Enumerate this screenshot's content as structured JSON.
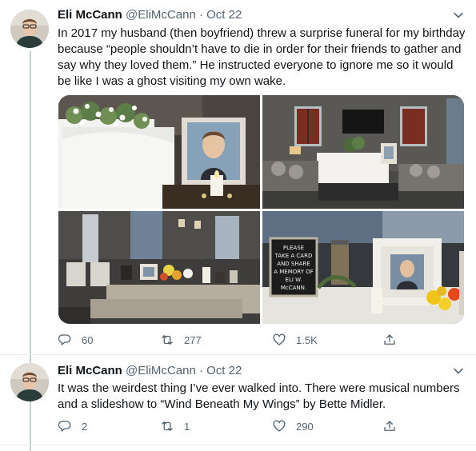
{
  "tweets": [
    {
      "author_name": "Eli McCann",
      "handle": "@EliMcCann",
      "separator": "·",
      "date": "Oct 22",
      "text": "In 2017 my husband (then boyfriend) threw a surprise funeral for my birthday because “people shouldn’t have to die in order for their friends to gather and say why they loved them.” He instructed everyone to ignore me so it would be like I was a ghost visiting my own wake.",
      "photos": [
        {
          "name": "photo-flowers-portrait"
        },
        {
          "name": "photo-living-room"
        },
        {
          "name": "photo-dining-table"
        },
        {
          "name": "photo-sign-portrait-candle",
          "sign_text": [
            "PLEASE",
            "TAKE A CARD",
            "AND SHARE",
            "A MEMORY OF",
            "ELI W.",
            "McCANN."
          ]
        }
      ],
      "actions": {
        "replies": "60",
        "retweets": "277",
        "likes": "1.5K"
      }
    },
    {
      "author_name": "Eli McCann",
      "handle": "@EliMcCann",
      "separator": "·",
      "date": "Oct 22",
      "text": "It was the weirdest thing I’ve ever walked into. There were musical numbers and a slideshow to “Wind Beneath My Wings” by Bette Midler.",
      "actions": {
        "replies": "2",
        "retweets": "1",
        "likes": "290"
      }
    }
  ],
  "colors": {
    "text": "#0f1419",
    "secondary": "#536471",
    "divider": "#e6ecf0",
    "thread_line": "#c4cfd6"
  },
  "icons": [
    "caret-down-icon",
    "reply-icon",
    "retweet-icon",
    "like-icon",
    "share-icon"
  ]
}
